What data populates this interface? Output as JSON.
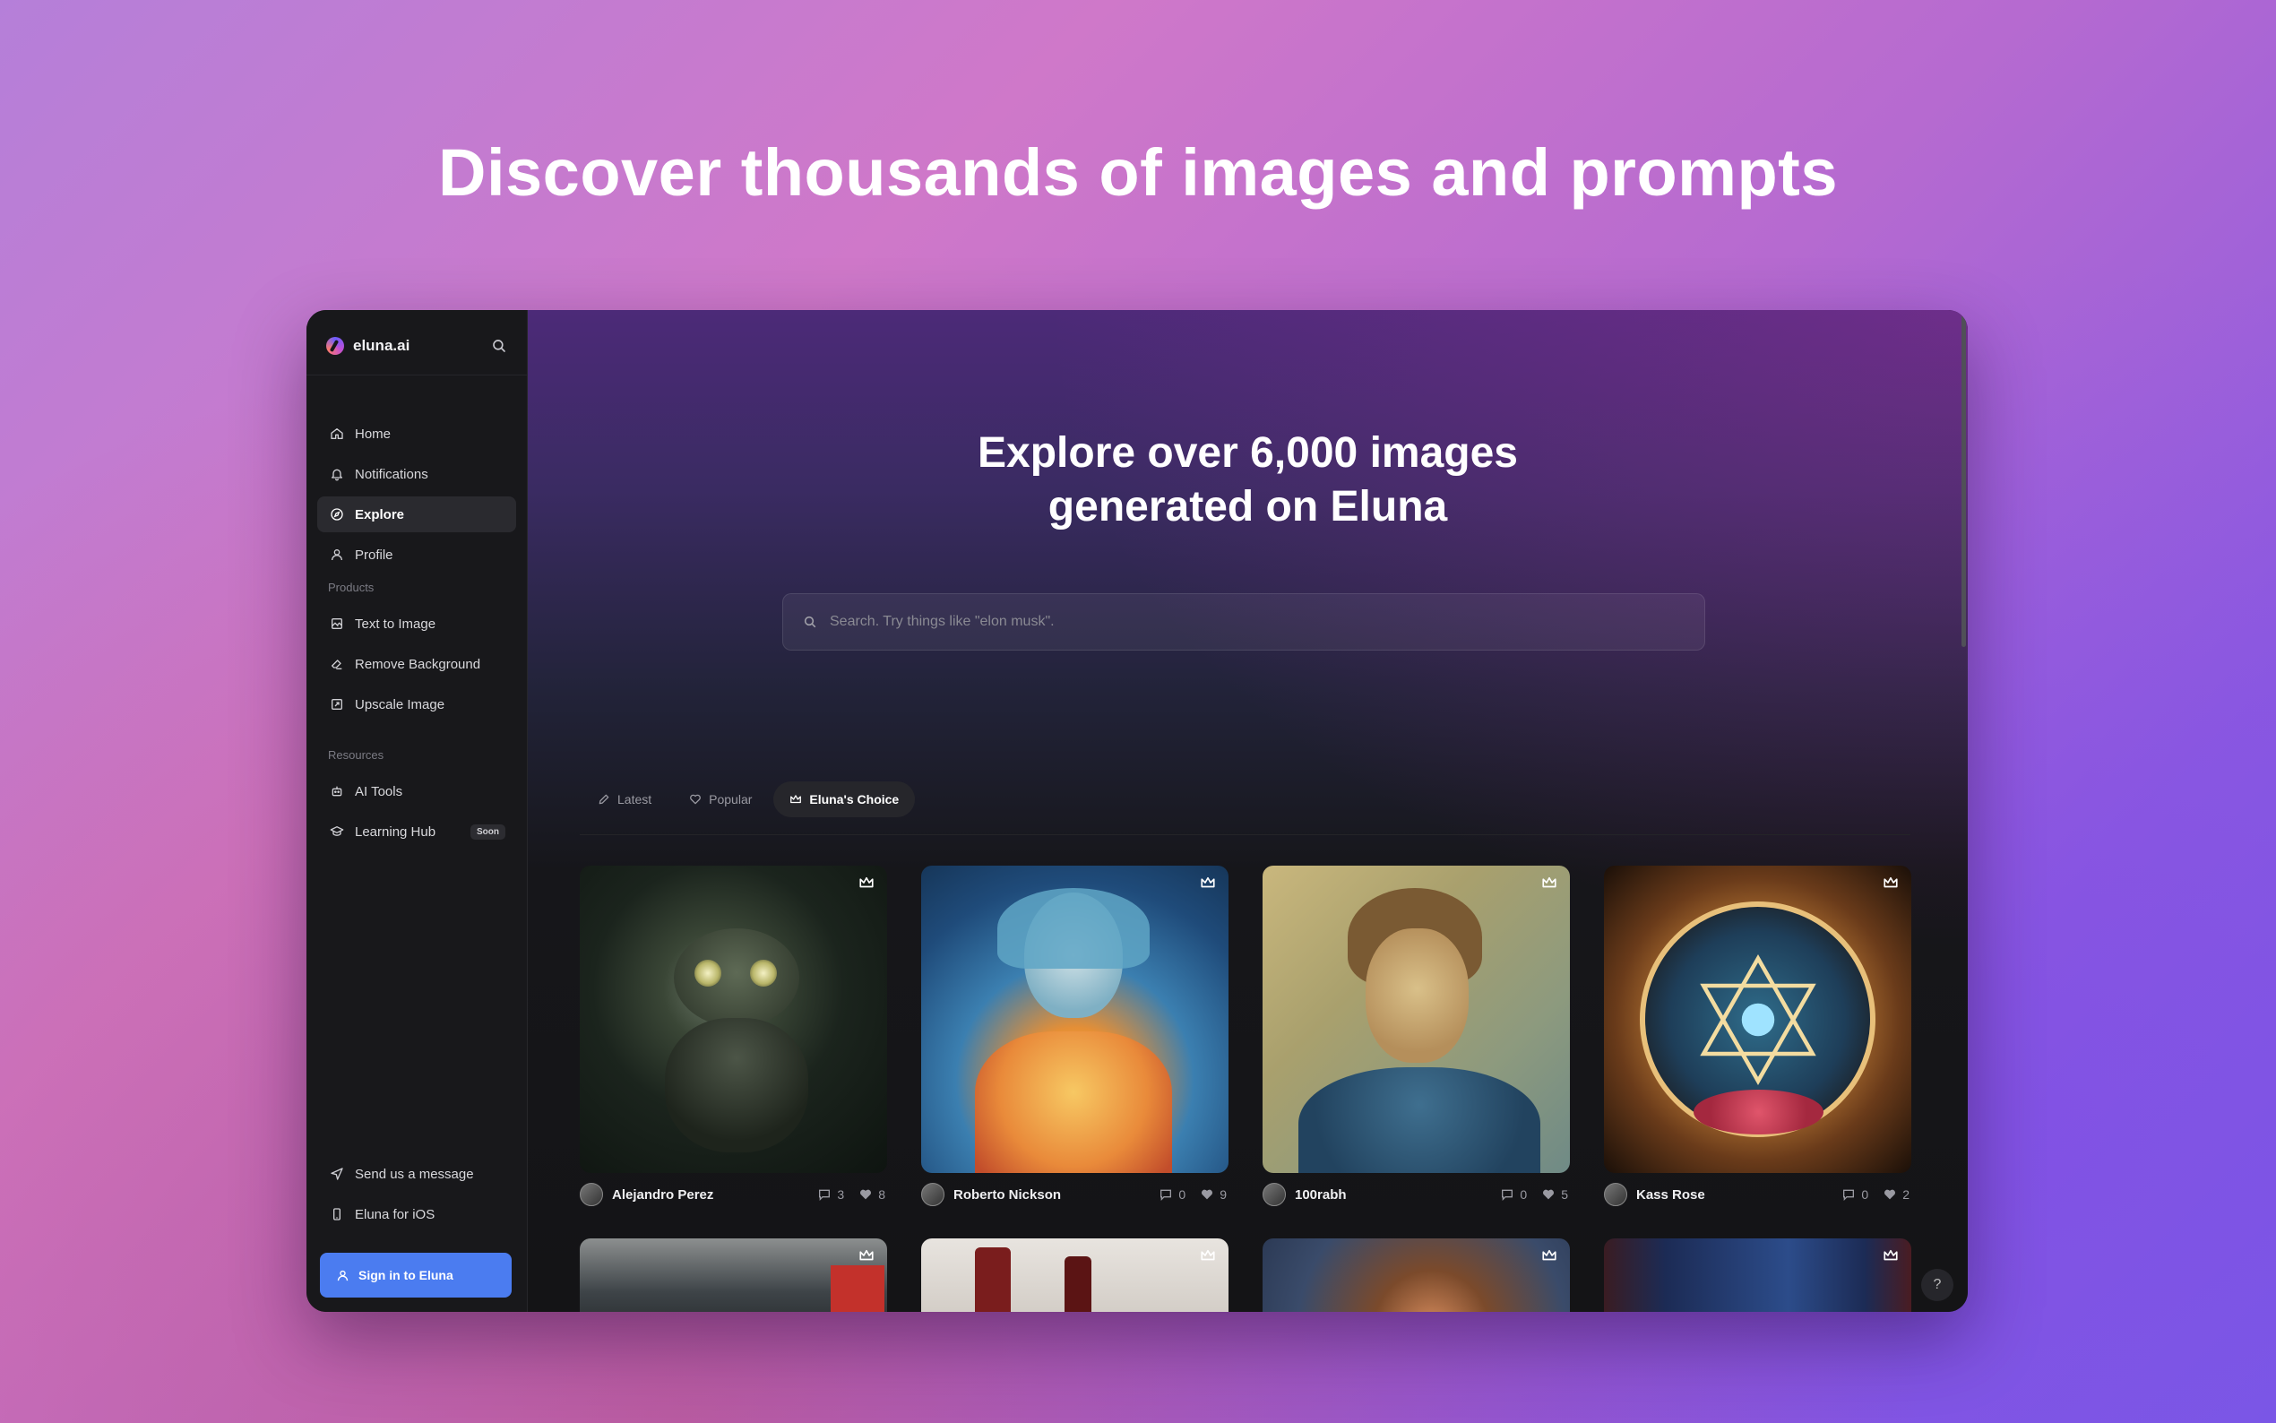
{
  "headline": "Discover thousands of images and prompts",
  "brand": {
    "name": "eluna.ai"
  },
  "sidebar": {
    "nav": [
      {
        "label": "Home",
        "icon": "home-icon"
      },
      {
        "label": "Notifications",
        "icon": "bell-icon"
      },
      {
        "label": "Explore",
        "icon": "compass-icon",
        "active": true
      },
      {
        "label": "Profile",
        "icon": "user-icon"
      }
    ],
    "products_label": "Products",
    "products": [
      {
        "label": "Text to Image",
        "icon": "image-icon"
      },
      {
        "label": "Remove Background",
        "icon": "eraser-icon"
      },
      {
        "label": "Upscale Image",
        "icon": "upscale-icon"
      }
    ],
    "resources_label": "Resources",
    "resources": [
      {
        "label": "AI Tools",
        "icon": "robot-icon"
      },
      {
        "label": "Learning Hub",
        "icon": "graduation-cap-icon",
        "badge": "Soon"
      }
    ],
    "footer": [
      {
        "label": "Send us a message",
        "icon": "send-icon"
      },
      {
        "label": "Eluna for iOS",
        "icon": "phone-icon"
      }
    ],
    "signin_label": "Sign in to Eluna"
  },
  "hero": {
    "line1": "Explore over 6,000 images",
    "line2": "generated on Eluna"
  },
  "search": {
    "placeholder": "Search. Try things like \"elon musk\"."
  },
  "tabs": [
    {
      "label": "Latest",
      "icon": "pencil-icon"
    },
    {
      "label": "Popular",
      "icon": "heart-icon"
    },
    {
      "label": "Eluna's Choice",
      "icon": "crown-icon",
      "active": true
    }
  ],
  "cards": [
    {
      "author": "Alejandro Perez",
      "comments": "3",
      "likes": "8"
    },
    {
      "author": "Roberto Nickson",
      "comments": "0",
      "likes": "9"
    },
    {
      "author": "100rabh",
      "comments": "0",
      "likes": "5"
    },
    {
      "author": "Kass Rose",
      "comments": "0",
      "likes": "2"
    }
  ],
  "help_label": "?",
  "colors": {
    "accent": "#4b7cf0",
    "window_bg": "#141416",
    "sidebar_bg": "#18181b"
  }
}
